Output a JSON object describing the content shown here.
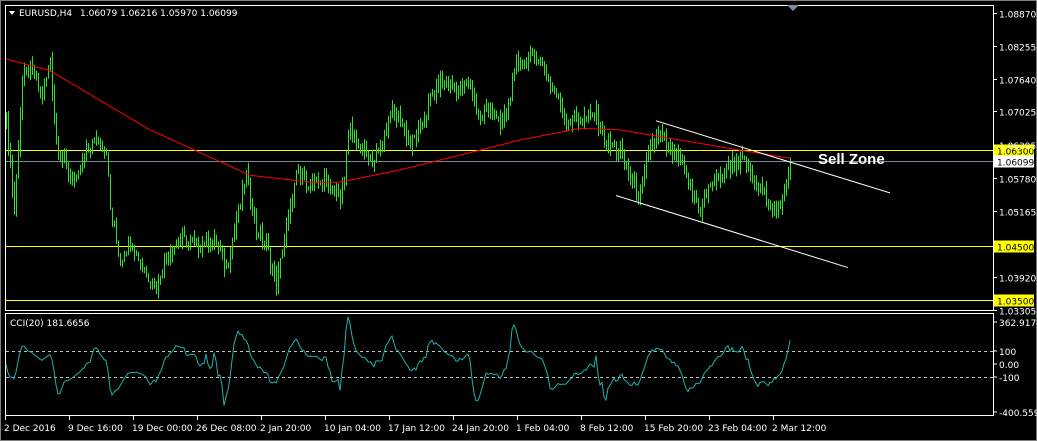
{
  "header": {
    "symbol": "EURUSD,H4",
    "ohlc": "1.06079 1.06216 1.05970 1.06099"
  },
  "annotation": {
    "sell_zone": "Sell Zone"
  },
  "colors": {
    "bars": "#33dd33",
    "ma": "#ff0000",
    "levels": "#ffff00",
    "current": "#778899",
    "cci": "#20b2aa",
    "trendlines": "#ffffff"
  },
  "chart_data": {
    "type": "line",
    "title": "EURUSD,H4",
    "price_axis": {
      "ylim": [
        1.03305,
        1.0887
      ],
      "ticks": [
        "1.08870",
        "1.08255",
        "1.07640",
        "1.07025",
        "1.05780",
        "1.05165",
        "1.03920",
        "1.03305"
      ],
      "tick_values": [
        1.0887,
        1.08255,
        1.0764,
        1.07025,
        1.0578,
        1.05165,
        1.0392,
        1.03305
      ],
      "hidden_tick": "1.06395"
    },
    "levels": [
      {
        "label": "1.06300",
        "value": 1.063
      },
      {
        "label": "1.04500",
        "value": 1.045
      },
      {
        "label": "1.03500",
        "value": 1.035
      }
    ],
    "current_price": {
      "label": "1.06099",
      "value": 1.06099
    },
    "x_axis": {
      "labels": [
        "2 Dec 2016",
        "9 Dec 16:00",
        "19 Dec 00:00",
        "26 Dec 08:00",
        "2 Jan 20:00",
        "10 Jan 04:00",
        "17 Jan 12:00",
        "24 Jan 20:00",
        "1 Feb 04:00",
        "8 Feb 12:00",
        "15 Feb 20:00",
        "23 Feb 04:00",
        "2 Mar 12:00"
      ],
      "bars_per_label": 32
    },
    "price_path": [
      [
        0,
        1.0687
      ],
      [
        4,
        1.0518
      ],
      [
        8,
        1.0761
      ],
      [
        12,
        1.078
      ],
      [
        18,
        1.0733
      ],
      [
        22,
        1.0799
      ],
      [
        25,
        1.0649
      ],
      [
        30,
        1.0593
      ],
      [
        35,
        1.0565
      ],
      [
        40,
        1.063
      ],
      [
        45,
        1.0649
      ],
      [
        50,
        1.063
      ],
      [
        52,
        1.0518
      ],
      [
        57,
        1.0424
      ],
      [
        62,
        1.0462
      ],
      [
        70,
        1.0396
      ],
      [
        75,
        1.0377
      ],
      [
        80,
        1.0434
      ],
      [
        87,
        1.0462
      ],
      [
        97,
        1.0452
      ],
      [
        105,
        1.0462
      ],
      [
        110,
        1.0405
      ],
      [
        115,
        1.0499
      ],
      [
        120,
        1.0583
      ],
      [
        125,
        1.0481
      ],
      [
        130,
        1.0452
      ],
      [
        135,
        1.0377
      ],
      [
        140,
        1.0481
      ],
      [
        145,
        1.0583
      ],
      [
        152,
        1.0565
      ],
      [
        160,
        1.0574
      ],
      [
        167,
        1.0537
      ],
      [
        172,
        1.0668
      ],
      [
        177,
        1.063
      ],
      [
        182,
        1.0612
      ],
      [
        187,
        1.063
      ],
      [
        192,
        1.0705
      ],
      [
        197,
        1.0687
      ],
      [
        202,
        1.064
      ],
      [
        207,
        1.0668
      ],
      [
        212,
        1.0724
      ],
      [
        217,
        1.0761
      ],
      [
        225,
        1.0743
      ],
      [
        232,
        1.0752
      ],
      [
        237,
        1.0687
      ],
      [
        242,
        1.0715
      ],
      [
        247,
        1.0668
      ],
      [
        252,
        1.0733
      ],
      [
        255,
        1.079
      ],
      [
        260,
        1.0799
      ],
      [
        265,
        1.0808
      ],
      [
        270,
        1.0771
      ],
      [
        275,
        1.0733
      ],
      [
        280,
        1.0687
      ],
      [
        287,
        1.0687
      ],
      [
        295,
        1.0696
      ],
      [
        300,
        1.064
      ],
      [
        307,
        1.063
      ],
      [
        312,
        1.0574
      ],
      [
        317,
        1.0546
      ],
      [
        322,
        1.064
      ],
      [
        327,
        1.0658
      ],
      [
        332,
        1.0621
      ],
      [
        337,
        1.0612
      ],
      [
        342,
        1.0556
      ],
      [
        347,
        1.0518
      ],
      [
        352,
        1.0565
      ],
      [
        357,
        1.0583
      ],
      [
        362,
        1.0602
      ],
      [
        367,
        1.0612
      ],
      [
        372,
        1.0583
      ],
      [
        377,
        1.0556
      ],
      [
        382,
        1.0527
      ],
      [
        387,
        1.0518
      ],
      [
        392,
        1.061
      ]
    ],
    "ma_path": [
      [
        0,
        1.0801
      ],
      [
        22,
        1.0779
      ],
      [
        72,
        1.0668
      ],
      [
        122,
        1.0583
      ],
      [
        152,
        1.057
      ],
      [
        167,
        1.057
      ],
      [
        197,
        1.0593
      ],
      [
        237,
        1.063
      ],
      [
        257,
        1.0649
      ],
      [
        287,
        1.0671
      ],
      [
        307,
        1.0668
      ],
      [
        337,
        1.0649
      ],
      [
        367,
        1.063
      ],
      [
        392,
        1.0615
      ]
    ],
    "trendlines": [
      {
        "from": [
          325,
          1.0685
        ],
        "to": [
          442,
          1.055
        ]
      },
      {
        "from": [
          305,
          1.0545
        ],
        "to": [
          421,
          1.041
        ]
      }
    ],
    "cci": {
      "label": "CCI(20) 181.6656",
      "period": 20,
      "ylim": [
        -400.5593,
        362.9172
      ],
      "levels": [
        100,
        -100
      ],
      "ticks": [
        "362.9172",
        "100",
        "0.00",
        "-100",
        "-400.5593"
      ],
      "tick_values": [
        362.9172,
        100,
        0,
        -100,
        -400.5593
      ]
    }
  }
}
